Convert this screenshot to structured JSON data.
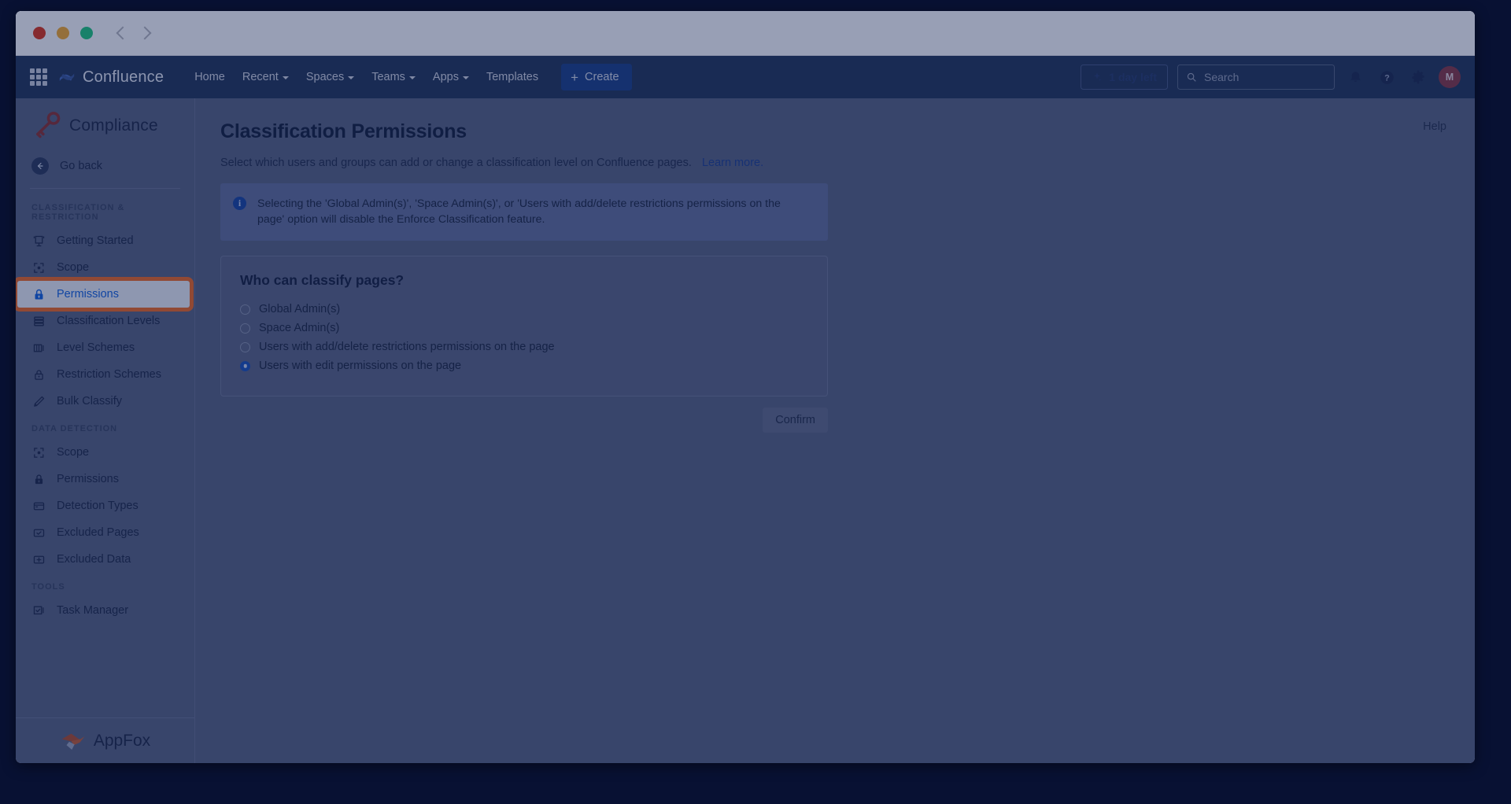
{
  "browser": {
    "traffic_lights": [
      "close",
      "minimize",
      "maximize"
    ],
    "back_label": "Back",
    "forward_label": "Forward"
  },
  "topnav": {
    "app_switcher": "app-switcher-icon",
    "brand": "Confluence",
    "items": [
      {
        "label": "Home",
        "has_caret": false
      },
      {
        "label": "Recent",
        "has_caret": true
      },
      {
        "label": "Spaces",
        "has_caret": true
      },
      {
        "label": "Teams",
        "has_caret": true
      },
      {
        "label": "Apps",
        "has_caret": true
      },
      {
        "label": "Templates",
        "has_caret": false
      }
    ],
    "create_label": "Create",
    "trial_label": "1 day left",
    "search_placeholder": "Search",
    "notifications_icon": "notification-bell-icon",
    "help_icon": "help-circle-icon",
    "settings_icon": "gear-icon",
    "avatar_initial": "M",
    "colors": {
      "nav_bg": "#253858",
      "create_bg": "#1e4387",
      "avatar_bg": "#8b3a44"
    }
  },
  "sidebar": {
    "title": "Compliance",
    "logo_icon": "key-icon",
    "go_back": "Go back",
    "sections": [
      {
        "label": "CLASSIFICATION & RESTRICTION",
        "items": [
          {
            "label": "Getting Started",
            "icon": "easel-icon",
            "active": false
          },
          {
            "label": "Scope",
            "icon": "target-scope-icon",
            "active": false
          },
          {
            "label": "Permissions",
            "icon": "lock-icon",
            "active": true
          },
          {
            "label": "Classification Levels",
            "icon": "layers-icon",
            "active": false
          },
          {
            "label": "Level Schemes",
            "icon": "columns-icon",
            "active": false
          },
          {
            "label": "Restriction Schemes",
            "icon": "padlock-icon",
            "active": false
          },
          {
            "label": "Bulk Classify",
            "icon": "pencil-icon",
            "active": false
          }
        ]
      },
      {
        "label": "DATA DETECTION",
        "items": [
          {
            "label": "Scope",
            "icon": "target-scope-icon",
            "active": false
          },
          {
            "label": "Permissions",
            "icon": "lock-icon",
            "active": false
          },
          {
            "label": "Detection Types",
            "icon": "card-icon",
            "active": false
          },
          {
            "label": "Excluded Pages",
            "icon": "checkbox-box-icon",
            "active": false
          },
          {
            "label": "Excluded Data",
            "icon": "plus-box-icon",
            "active": false
          }
        ]
      },
      {
        "label": "TOOLS",
        "items": [
          {
            "label": "Task Manager",
            "icon": "task-check-icon",
            "active": false
          }
        ]
      }
    ],
    "footer_brand": "AppFox",
    "active_highlight_color": "#f36b21"
  },
  "main": {
    "help_label": "Help",
    "title": "Classification Permissions",
    "subtitle": "Select which users and groups can add or change a classification level on Confluence pages.",
    "learn_more": "Learn more.",
    "info_banner": {
      "icon": "info-icon",
      "text": "Selecting the 'Global Admin(s)', 'Space Admin(s)', or 'Users with add/delete restrictions permissions on the page' option will disable the Enforce Classification feature."
    },
    "card": {
      "title": "Who can classify pages?",
      "options": [
        {
          "label": "Global Admin(s)",
          "selected": false
        },
        {
          "label": "Space Admin(s)",
          "selected": false
        },
        {
          "label": "Users with add/delete restrictions permissions on the page",
          "selected": false
        },
        {
          "label": "Users with edit permissions on the page",
          "selected": true
        }
      ]
    },
    "confirm_label": "Confirm"
  }
}
